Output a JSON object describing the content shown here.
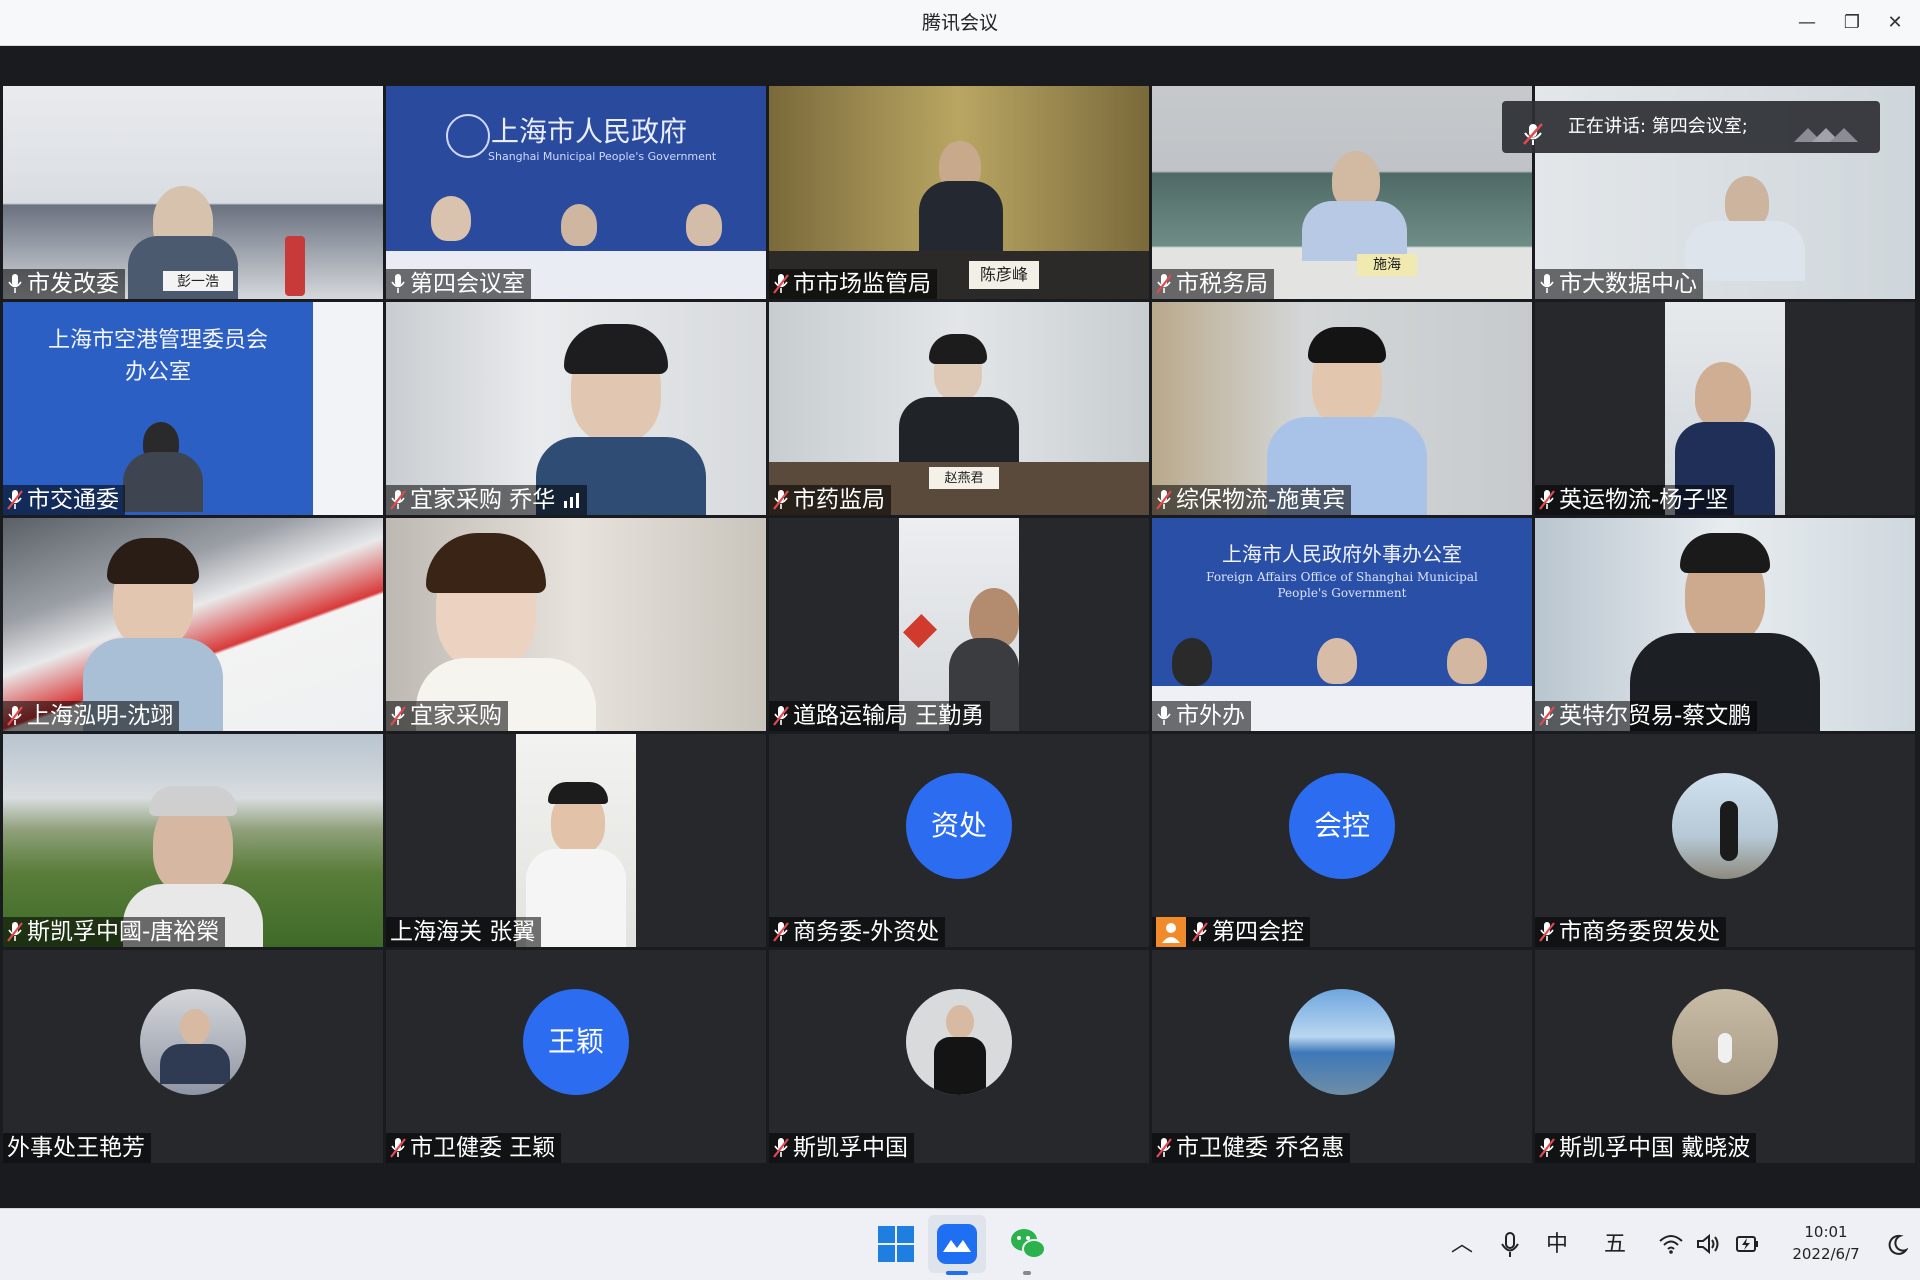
{
  "window": {
    "title": "腾讯会议",
    "minimize": "—",
    "maximize": "❐",
    "close": "✕"
  },
  "speaking": {
    "label": "正在讲话: 第四会议室;"
  },
  "participants": [
    {
      "name": "市发改委",
      "muted": false
    },
    {
      "name": "第四会议室",
      "muted": false
    },
    {
      "name": "市市场监管局",
      "muted": true
    },
    {
      "name": "市税务局",
      "muted": true
    },
    {
      "name": "市大数据中心",
      "muted": false
    },
    {
      "name": "市交通委",
      "muted": true
    },
    {
      "name": "宜家采购 乔华",
      "muted": true
    },
    {
      "name": "市药监局",
      "muted": true
    },
    {
      "name": "综保物流-施黄宾",
      "muted": true
    },
    {
      "name": "英运物流-杨子坚",
      "muted": true
    },
    {
      "name": "上海泓明-沈翊",
      "muted": true
    },
    {
      "name": "宜家采购",
      "muted": true
    },
    {
      "name": "道路运输局 王勤勇",
      "muted": true
    },
    {
      "name": "市外办",
      "muted": false
    },
    {
      "name": "英特尔贸易-蔡文鹏",
      "muted": true
    },
    {
      "name": "斯凯孚中國-唐裕榮",
      "muted": true
    },
    {
      "name": "上海海关 张翼",
      "muted": null
    },
    {
      "name": "商务委-外资处",
      "muted": true,
      "avatar_text": "资处"
    },
    {
      "name": "第四会控",
      "muted": true,
      "avatar_text": "会控"
    },
    {
      "name": "市商务委贸发处",
      "muted": true
    },
    {
      "name": "外事处王艳芳",
      "muted": null
    },
    {
      "name": "市卫健委 王颖",
      "muted": true,
      "avatar_text": "王颖"
    },
    {
      "name": "斯凯孚中国",
      "muted": true
    },
    {
      "name": "市卫健委  乔名惠",
      "muted": true
    },
    {
      "name": "斯凯孚中国 戴晓波",
      "muted": true
    }
  ],
  "backdrops": {
    "gov_banner_cn": "上海市人民政府",
    "gov_banner_en": "Shanghai Municipal People's Government",
    "airport_banner_1": "上海市空港管理委员会",
    "airport_banner_2": "办公室",
    "fao_banner_cn": "上海市人民政府外事办公室",
    "fao_banner_en_1": "Foreign Affairs Office of Shanghai Municipal",
    "fao_banner_en_2": "People's Government",
    "nameplate_1": "彭一浩",
    "nameplate_3": "陈彦峰",
    "nameplate_4": "施海",
    "nameplate_8": "赵燕君"
  },
  "taskbar": {
    "tray": {
      "chevron": "︿",
      "ime_1": "中",
      "ime_2": "五"
    },
    "time": "10:01",
    "date": "2022/6/7"
  },
  "colors": {
    "accent": "#2b6cf0",
    "tile_bg": "#26282c",
    "muted_red": "#e5484d"
  }
}
